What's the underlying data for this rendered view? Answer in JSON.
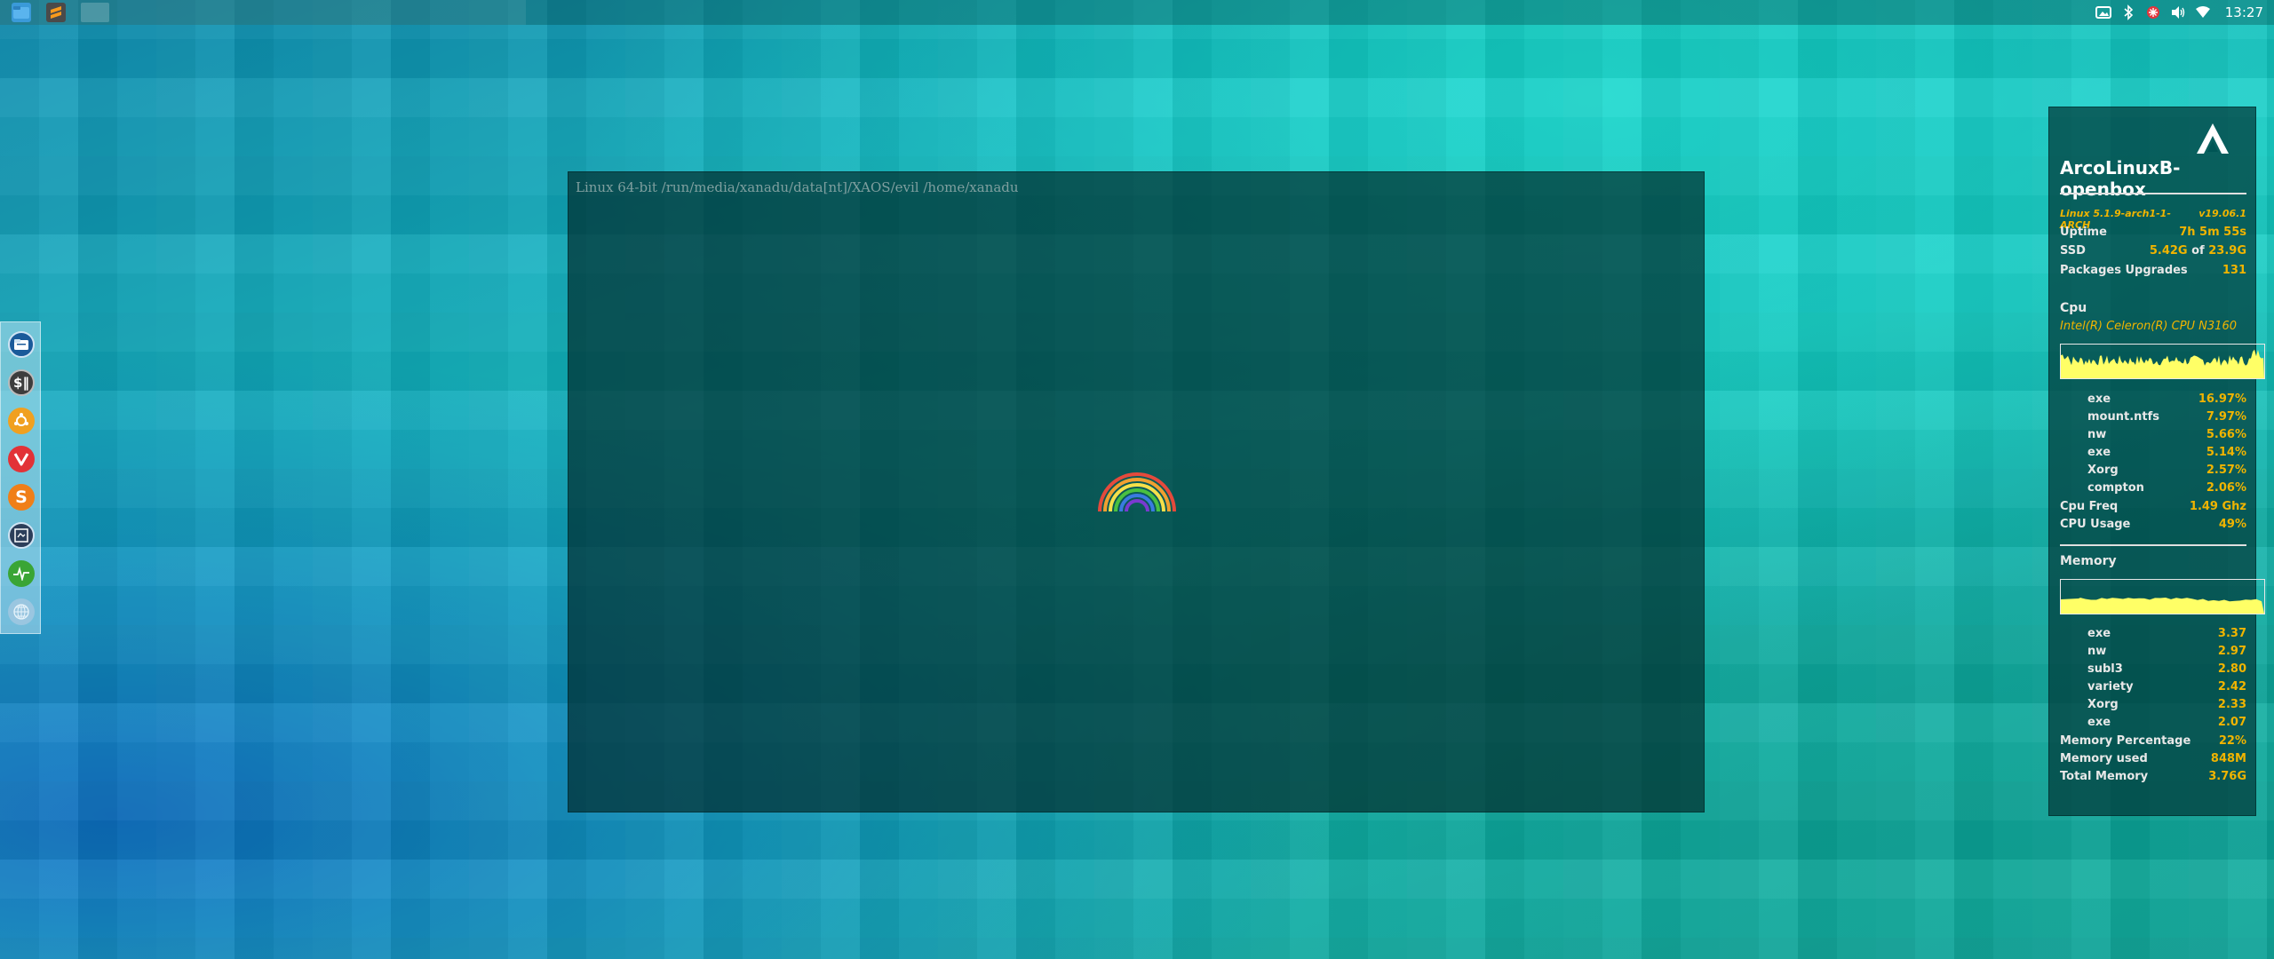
{
  "top_panel": {
    "apps": [
      "file-manager-icon",
      "sublime-text-icon",
      "window-button"
    ],
    "tray_icons": [
      "screenshot-icon",
      "bluetooth-icon",
      "update-notifier-icon",
      "volume-icon",
      "wifi-icon"
    ],
    "clock": "13:27"
  },
  "dock": {
    "items": [
      "file-manager-icon",
      "terminal-icon",
      "ubuntu-tweak-icon",
      "vivaldi-icon",
      "sublime-icon",
      "screenshot-tool-icon",
      "system-monitor-icon",
      "network-icon"
    ]
  },
  "center_window": {
    "path": "Linux 64-bit /run/media/xanadu/data[nt]/XAOS/evil /home/xanadu"
  },
  "conky": {
    "hostname": "ArcoLinuxB-openbox",
    "kernel": "Linux 5.1.9-arch1-1-ARCH",
    "version": "v19.06.1",
    "uptime_label": "Uptime",
    "uptime_value": "7h 5m 55s",
    "ssd_label": "SSD",
    "ssd_used": "5.42G",
    "ssd_of": "of",
    "ssd_total": "23.9G",
    "packages_label": "Packages Upgrades",
    "packages_value": "131",
    "cpu_heading": "Cpu",
    "cpu_name": "Intel(R) Celeron(R) CPU  N3160",
    "cpu_processes": [
      {
        "name": "exe",
        "value": "16.97%"
      },
      {
        "name": "mount.ntfs",
        "value": "7.97%"
      },
      {
        "name": "nw",
        "value": "5.66%"
      },
      {
        "name": "exe",
        "value": "5.14%"
      },
      {
        "name": "Xorg",
        "value": "2.57%"
      },
      {
        "name": "compton",
        "value": "2.06%"
      }
    ],
    "cpu_freq_label": "Cpu Freq",
    "cpu_freq_value": "1.49 Ghz",
    "cpu_usage_label": "CPU Usage",
    "cpu_usage_value": "49%",
    "memory_heading": "Memory",
    "mem_processes": [
      {
        "name": "exe",
        "value": "3.37"
      },
      {
        "name": "nw",
        "value": "2.97"
      },
      {
        "name": "subl3",
        "value": "2.80"
      },
      {
        "name": "variety",
        "value": "2.42"
      },
      {
        "name": "Xorg",
        "value": "2.33"
      },
      {
        "name": "exe",
        "value": "2.07"
      }
    ],
    "mem_pct_label": "Memory Percentage",
    "mem_pct_value": "22%",
    "mem_used_label": "Memory used",
    "mem_used_value": "848M",
    "mem_total_label": "Total Memory",
    "mem_total_value": "3.76G",
    "accent_color": "#f0b400",
    "graph_color": "#ffff66"
  }
}
